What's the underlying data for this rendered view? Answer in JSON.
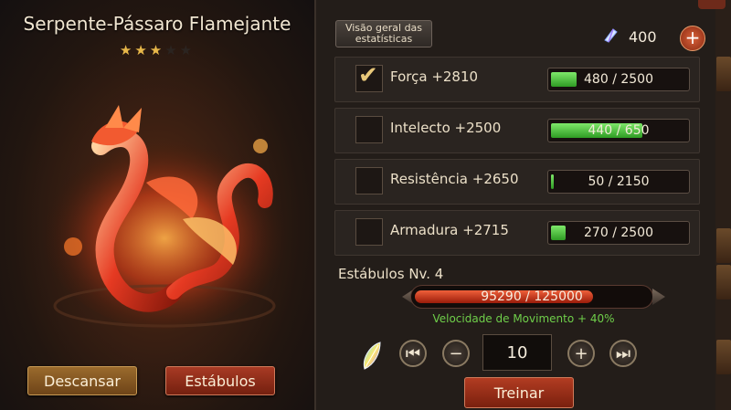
{
  "creature": {
    "name": "Serpente-Pássaro Flamejante",
    "stars_filled": 3,
    "stars_total": 5
  },
  "left_buttons": {
    "rest": "Descansar",
    "stables": "Estábulos"
  },
  "header": {
    "stats_overview": "Visão geral das estatísticas",
    "gem_count": "400",
    "add_label": "+"
  },
  "stats": [
    {
      "label": "Força  +2810",
      "checked": true,
      "bar": "480 / 2500",
      "fraction": 0.192
    },
    {
      "label": "Intelecto  +2500",
      "checked": false,
      "bar": "440 / 650",
      "fraction": 0.677
    },
    {
      "label": "Resistência  +2650",
      "checked": false,
      "bar": "50 / 2150",
      "fraction": 0.023
    },
    {
      "label": "Armadura  +2715",
      "checked": false,
      "bar": "270 / 2500",
      "fraction": 0.108
    }
  ],
  "stables": {
    "level_label": "Estábulos Nv. 4",
    "xp_text": "95290 / 125000",
    "xp_fraction": 0.762,
    "bonus_text": "Velocidade de Movimento + 40%"
  },
  "training": {
    "quantity": "10",
    "train_label": "Treinar"
  },
  "colors": {
    "accent_green": "#6fcf4a",
    "xp_red": "#d8452a",
    "button_red": "#a83a24",
    "button_gold": "#9a6a2c"
  }
}
